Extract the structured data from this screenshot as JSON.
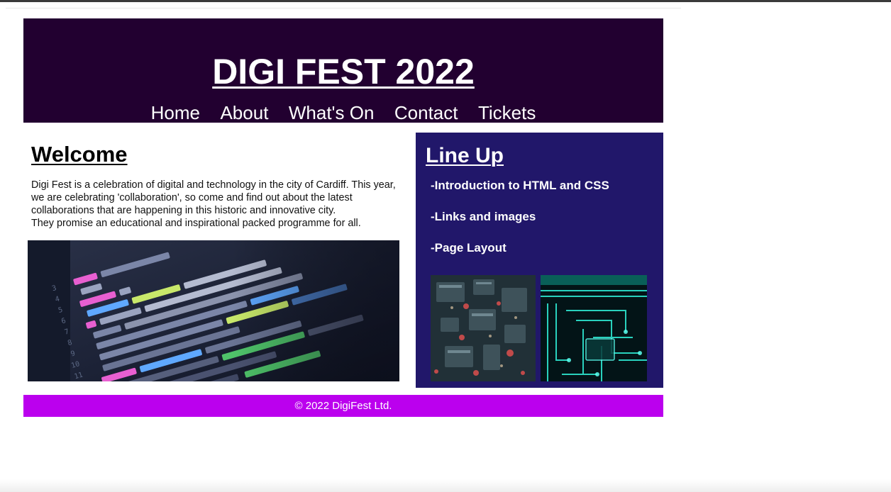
{
  "site": {
    "title": "DIGI FEST 2022"
  },
  "nav": [
    "Home",
    "About",
    "What's On",
    "Contact",
    "Tickets"
  ],
  "welcome": {
    "heading": "Welcome",
    "paragraph_1": "Digi Fest is a celebration of digital and technology in the city of Cardiff. This year, we are celebrating 'collaboration', so come and find out about the latest collaborations that are happening in this historic and innovative city.",
    "paragraph_2": "They promise an educational and inspirational packed programme for all.",
    "image_icon": "code-editor-photo"
  },
  "lineup": {
    "heading": "Line Up",
    "items": [
      "-Introduction to HTML and CSS",
      "-Links and images",
      "-Page Layout"
    ],
    "images": [
      "circuit-board-photo",
      "glowing-circuit-photo"
    ]
  },
  "footer": {
    "text": "© 2022 DigiFest Ltd."
  },
  "colors": {
    "header_bg": "#220030",
    "lineup_bg": "#21176a",
    "footer_bg": "#bb00ee",
    "text_light": "#ffffff"
  }
}
